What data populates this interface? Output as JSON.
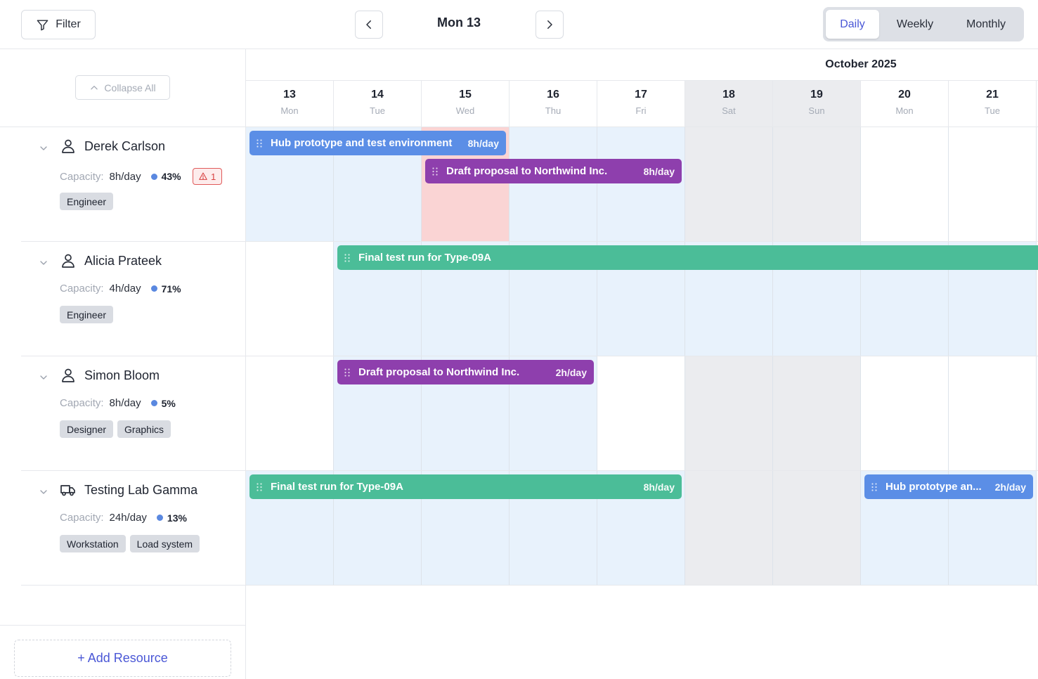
{
  "toolbar": {
    "filter_label": "Filter",
    "current_date": "Mon 13",
    "views": [
      {
        "label": "Daily",
        "active": true
      },
      {
        "label": "Weekly",
        "active": false
      },
      {
        "label": "Monthly",
        "active": false
      }
    ]
  },
  "sidebar": {
    "collapse_label": "Collapse All",
    "add_resource_label": "+ Add Resource",
    "capacity_label": "Capacity:"
  },
  "calendar": {
    "month_label": "October 2025",
    "days": [
      {
        "num": "13",
        "name": "Mon",
        "weekend": false
      },
      {
        "num": "14",
        "name": "Tue",
        "weekend": false
      },
      {
        "num": "15",
        "name": "Wed",
        "weekend": false
      },
      {
        "num": "16",
        "name": "Thu",
        "weekend": false
      },
      {
        "num": "17",
        "name": "Fri",
        "weekend": false
      },
      {
        "num": "18",
        "name": "Sat",
        "weekend": true
      },
      {
        "num": "19",
        "name": "Sun",
        "weekend": true
      },
      {
        "num": "20",
        "name": "Mon",
        "weekend": false
      },
      {
        "num": "21",
        "name": "Tue",
        "weekend": false
      }
    ]
  },
  "resources": [
    {
      "name": "Derek Carlson",
      "icon": "person-icon",
      "capacity": "8h/day",
      "utilization": "43%",
      "warning_count": "1",
      "tags": [
        "Engineer"
      ],
      "cells": [
        "blue",
        "blue",
        "red",
        "blue",
        "blue",
        "grey",
        "grey",
        "white",
        "white"
      ],
      "tasks": [
        {
          "title": "Hub prototype and test environment",
          "rate": "8h/day",
          "color": "blue",
          "start": 0,
          "days": 3,
          "lane": 0
        },
        {
          "title": "Draft proposal to Northwind Inc.",
          "rate": "8h/day",
          "color": "purple",
          "start": 2,
          "days": 3,
          "lane": 1
        }
      ]
    },
    {
      "name": "Alicia Prateek",
      "icon": "person-icon",
      "capacity": "4h/day",
      "utilization": "71%",
      "warning_count": "",
      "tags": [
        "Engineer"
      ],
      "cells": [
        "white",
        "blue",
        "blue",
        "blue",
        "blue",
        "blue",
        "blue",
        "blue",
        "blue"
      ],
      "tasks": [
        {
          "title": "Final test run for Type-09A",
          "rate": "",
          "color": "green",
          "start": 1,
          "days": 9,
          "lane": 0
        }
      ]
    },
    {
      "name": "Simon Bloom",
      "icon": "person-icon",
      "capacity": "8h/day",
      "utilization": "5%",
      "warning_count": "",
      "tags": [
        "Designer",
        "Graphics"
      ],
      "cells": [
        "white",
        "blue",
        "blue",
        "blue",
        "white",
        "grey",
        "grey",
        "white",
        "white"
      ],
      "tasks": [
        {
          "title": "Draft proposal to Northwind Inc.",
          "rate": "2h/day",
          "color": "purple",
          "start": 1,
          "days": 3,
          "lane": 0
        }
      ]
    },
    {
      "name": "Testing Lab Gamma",
      "icon": "truck-icon",
      "capacity": "24h/day",
      "utilization": "13%",
      "warning_count": "",
      "tags": [
        "Workstation",
        "Load system"
      ],
      "cells": [
        "blue",
        "blue",
        "blue",
        "blue",
        "blue",
        "grey",
        "grey",
        "blue",
        "blue"
      ],
      "tasks": [
        {
          "title": "Final test run for Type-09A",
          "rate": "8h/day",
          "color": "green",
          "start": 0,
          "days": 5,
          "lane": 0
        },
        {
          "title": "Hub prototype an...",
          "rate": "2h/day",
          "color": "blue",
          "start": 7,
          "days": 2,
          "lane": 0
        }
      ]
    }
  ]
}
